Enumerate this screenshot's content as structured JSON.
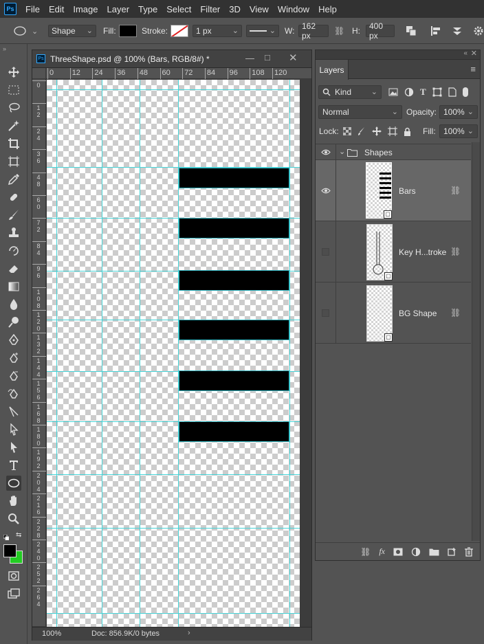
{
  "menubar": {
    "logo": "Ps",
    "items": [
      "File",
      "Edit",
      "Image",
      "Layer",
      "Type",
      "Select",
      "Filter",
      "3D",
      "View",
      "Window",
      "Help"
    ]
  },
  "options": {
    "tool_mode": "Shape",
    "fill_label": "Fill:",
    "stroke_label": "Stroke:",
    "stroke_width": "1 px",
    "w_label": "W:",
    "w_value": "162 px",
    "h_label": "H:",
    "h_value": "400 px"
  },
  "document": {
    "title": "ThreeShape.psd @ 100% (Bars, RGB/8#) *",
    "zoom": "100%",
    "doc_info": "Doc: 856.9K/0 bytes",
    "h_ruler_ticks": [
      "0",
      "12",
      "24",
      "36",
      "48",
      "60",
      "72",
      "84",
      "96",
      "108",
      "120"
    ],
    "v_ruler_ticks": [
      "0",
      "12",
      "24",
      "36",
      "48",
      "60",
      "72",
      "84",
      "96",
      "108",
      "120",
      "132",
      "144",
      "156",
      "168",
      "180",
      "192",
      "204",
      "216",
      "228",
      "240",
      "252",
      "264"
    ]
  },
  "layers_panel": {
    "tab": "Layers",
    "filter_kind": "Kind",
    "blend_mode": "Normal",
    "opacity_label": "Opacity:",
    "opacity_value": "100%",
    "lock_label": "Lock:",
    "fill_label": "Fill:",
    "fill_value": "100%",
    "group": {
      "name": "Shapes",
      "expanded": true,
      "visible": true
    },
    "layers": [
      {
        "name": "Bars",
        "visible": true,
        "selected": true
      },
      {
        "name": "Key H...troke",
        "visible": false,
        "selected": false
      },
      {
        "name": "BG Shape",
        "visible": false,
        "selected": false
      }
    ]
  },
  "colors": {
    "foreground": "#000000",
    "background": "#22cc22",
    "guide": "#46d4d8",
    "accent": "#31a8ff"
  }
}
